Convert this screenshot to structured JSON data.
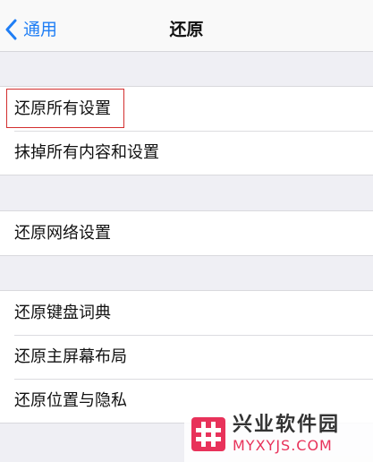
{
  "nav": {
    "back_label": "通用",
    "title": "还原"
  },
  "groups": [
    {
      "items": [
        {
          "label": "还原所有设置",
          "highlighted": true
        },
        {
          "label": "抹掉所有内容和设置"
        }
      ]
    },
    {
      "items": [
        {
          "label": "还原网络设置"
        }
      ]
    },
    {
      "items": [
        {
          "label": "还原键盘词典"
        },
        {
          "label": "还原主屏幕布局"
        },
        {
          "label": "还原位置与隐私"
        }
      ]
    }
  ],
  "watermark": {
    "title": "兴业软件园",
    "url": "MYXYJS.COM"
  },
  "colors": {
    "accent": "#1f7ef5",
    "background": "#efeff4",
    "highlight": "#d32f2f",
    "watermark_brand": "#e8325a"
  },
  "icons": {
    "back": "chevron-left-icon",
    "watermark_logo": "hash-logo-icon"
  }
}
